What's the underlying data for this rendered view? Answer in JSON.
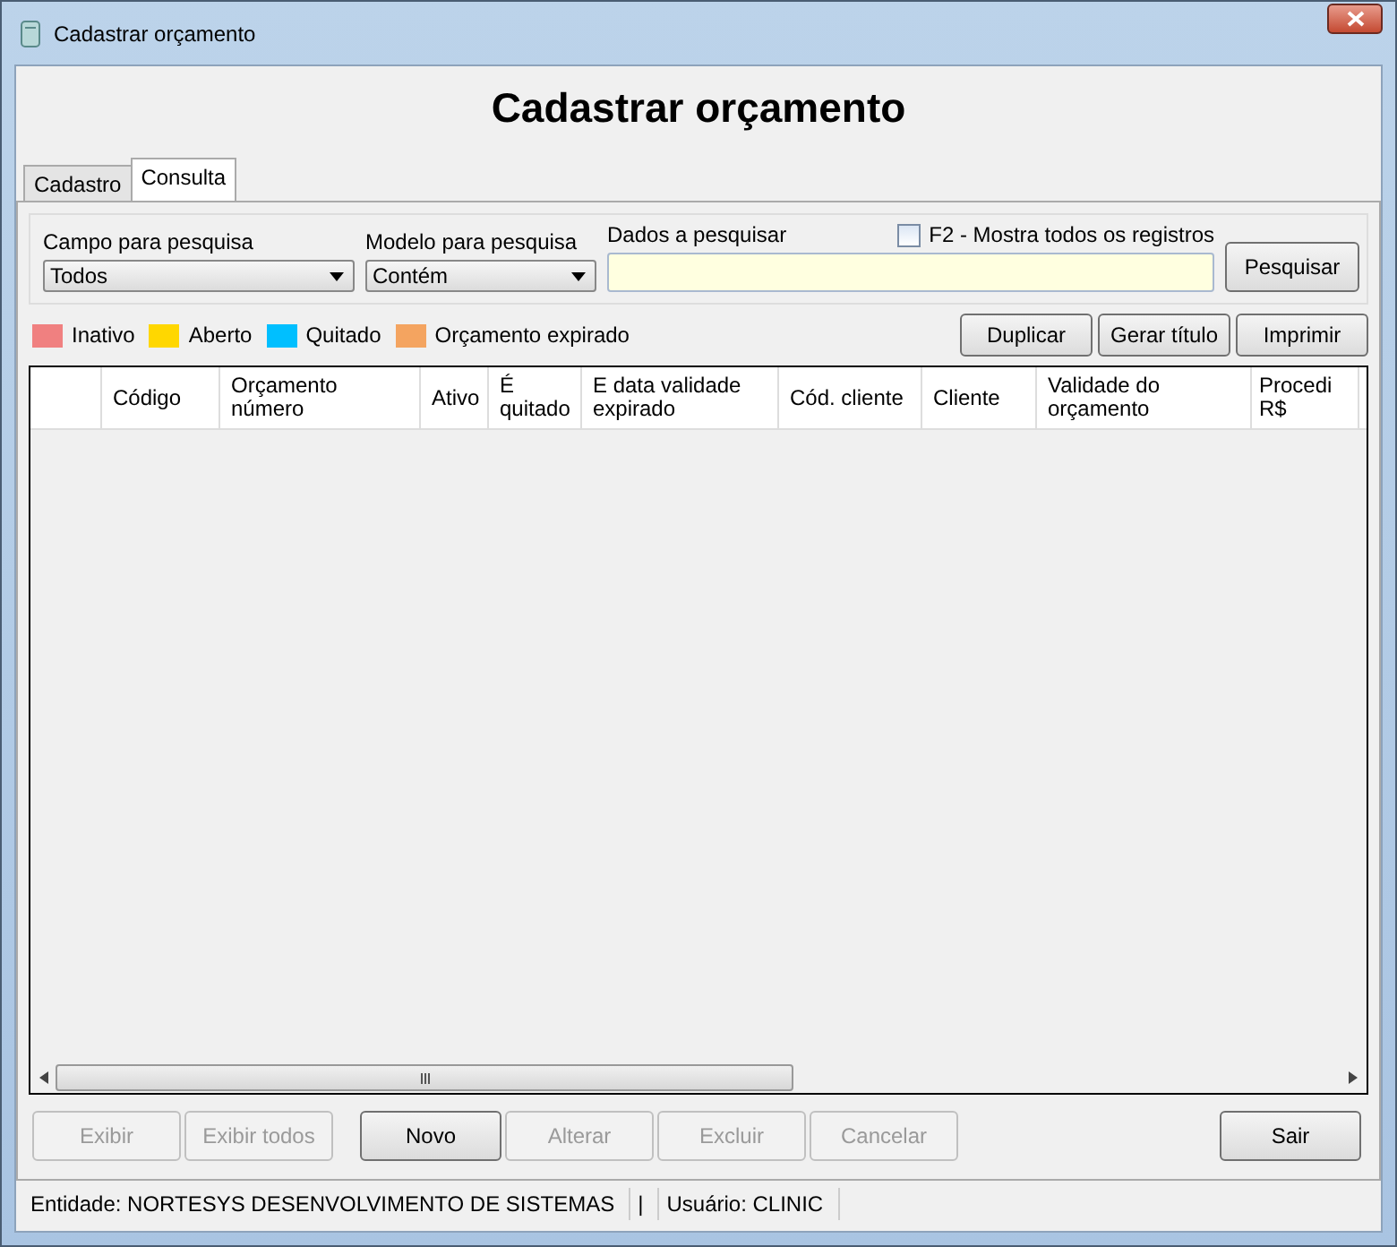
{
  "window": {
    "title": "Cadastrar orçamento"
  },
  "heading": "Cadastrar orçamento",
  "tabs": [
    {
      "label": "Cadastro",
      "selected": false
    },
    {
      "label": "Consulta",
      "selected": true
    }
  ],
  "search": {
    "field_label": "Campo para pesquisa",
    "field_value": "Todos",
    "model_label": "Modelo para pesquisa",
    "model_value": "Contém",
    "data_label": "Dados a pesquisar",
    "show_all": {
      "label": "F2 - Mostra todos os registros",
      "checked": false
    },
    "button": "Pesquisar"
  },
  "legend": [
    {
      "label": "Inativo",
      "color": "#f08080"
    },
    {
      "label": "Aberto",
      "color": "#ffd700"
    },
    {
      "label": "Quitado",
      "color": "#00bfff"
    },
    {
      "label": "Orçamento expirado",
      "color": "#f4a460"
    }
  ],
  "actions": [
    "Duplicar",
    "Gerar título",
    "Imprimir"
  ],
  "table": {
    "columns": [
      "Código",
      "Orçamento número",
      "Ativo",
      "É quitado",
      "E data validade expirado",
      "Cód. cliente",
      "Cliente",
      "Validade do orçamento",
      "Procedi R$"
    ]
  },
  "buttons": [
    {
      "label": "Exibir",
      "disabled": true
    },
    {
      "label": "Exibir todos",
      "disabled": true
    },
    {
      "label": "Novo",
      "disabled": false
    },
    {
      "label": "Alterar",
      "disabled": true
    },
    {
      "label": "Excluir",
      "disabled": true
    },
    {
      "label": "Cancelar",
      "disabled": true
    },
    {
      "label": "Sair",
      "disabled": false
    }
  ],
  "status_bar": [
    "Entidade: NORTESYS DESENVOLVIMENTO DE SISTEMAS",
    "|",
    "Usuário: CLINIC"
  ]
}
